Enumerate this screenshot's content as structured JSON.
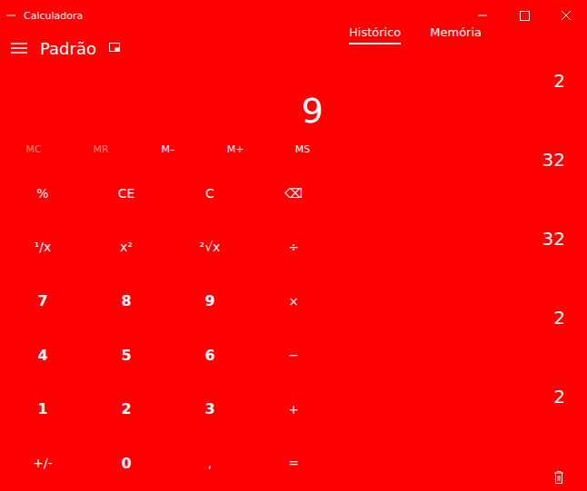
{
  "window": {
    "title": "Calculadora"
  },
  "header": {
    "mode": "Padrão"
  },
  "display": {
    "value": "9"
  },
  "memory": [
    {
      "label": "MC",
      "disabled": true
    },
    {
      "label": "MR",
      "disabled": true
    },
    {
      "label": "M–",
      "disabled": false
    },
    {
      "label": "M+",
      "disabled": false
    },
    {
      "label": "MS",
      "disabled": false
    }
  ],
  "keys": [
    {
      "label": "%",
      "kind": "op"
    },
    {
      "label": "CE",
      "kind": "op"
    },
    {
      "label": "C",
      "kind": "op"
    },
    {
      "label": "⌫",
      "kind": "op"
    },
    {
      "label": "¹/x",
      "kind": "op"
    },
    {
      "label": "x²",
      "kind": "op"
    },
    {
      "label": "²√x",
      "kind": "op"
    },
    {
      "label": "÷",
      "kind": "op"
    },
    {
      "label": "7",
      "kind": "digit"
    },
    {
      "label": "8",
      "kind": "digit"
    },
    {
      "label": "9",
      "kind": "digit"
    },
    {
      "label": "×",
      "kind": "op"
    },
    {
      "label": "4",
      "kind": "digit"
    },
    {
      "label": "5",
      "kind": "digit"
    },
    {
      "label": "6",
      "kind": "digit"
    },
    {
      "label": "−",
      "kind": "op"
    },
    {
      "label": "1",
      "kind": "digit"
    },
    {
      "label": "2",
      "kind": "digit"
    },
    {
      "label": "3",
      "kind": "digit"
    },
    {
      "label": "+",
      "kind": "op"
    },
    {
      "label": "+/-",
      "kind": "op"
    },
    {
      "label": "0",
      "kind": "digit"
    },
    {
      "label": ",",
      "kind": "op"
    },
    {
      "label": "=",
      "kind": "op"
    }
  ],
  "tabs": [
    {
      "label": "Histórico",
      "selected": true
    },
    {
      "label": "Memória",
      "selected": false
    }
  ],
  "history": [
    {
      "result": "2"
    },
    {
      "result": "32"
    },
    {
      "result": "32"
    },
    {
      "result": "2"
    },
    {
      "result": "2"
    }
  ]
}
